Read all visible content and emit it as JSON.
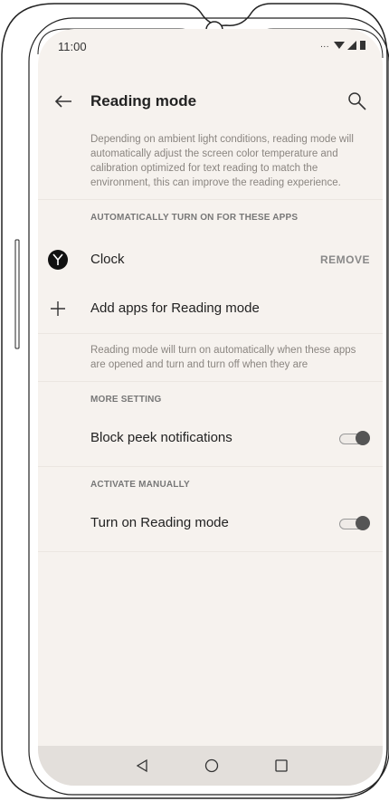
{
  "status": {
    "time": "11:00",
    "dots": "..."
  },
  "header": {
    "title": "Reading mode"
  },
  "intro_text": "Depending on ambient light conditions, reading mode will automatically adjust the screen color temperature and calibration optimized for text reading to match the environment, this can  improve the reading experience.",
  "auto_section": {
    "heading": "AUTOMATICALLY TURN ON FOR THESE APPS",
    "apps": [
      {
        "name": "Clock",
        "action": "REMOVE"
      }
    ],
    "add_label": "Add apps for Reading mode",
    "footnote": "Reading mode will turn on automatically when these apps are opened and turn and turn off when they are"
  },
  "more_section": {
    "heading": "MORE SETTING",
    "block_peek_label": "Block peek notifications"
  },
  "manual_section": {
    "heading": "ACTIVATE MANUALLY",
    "turn_on_label": "Turn on Reading mode"
  },
  "icons": {
    "back": "back-arrow-icon",
    "search": "search-icon",
    "clock": "clock-icon",
    "add": "plus-icon",
    "nav_back": "triangle-back-icon",
    "nav_home": "circle-home-icon",
    "nav_recents": "square-recents-icon"
  },
  "colors": {
    "screen_background": "#f6f2ee",
    "nav_background": "#e3dfdb",
    "toggle_thumb": "#555555"
  }
}
